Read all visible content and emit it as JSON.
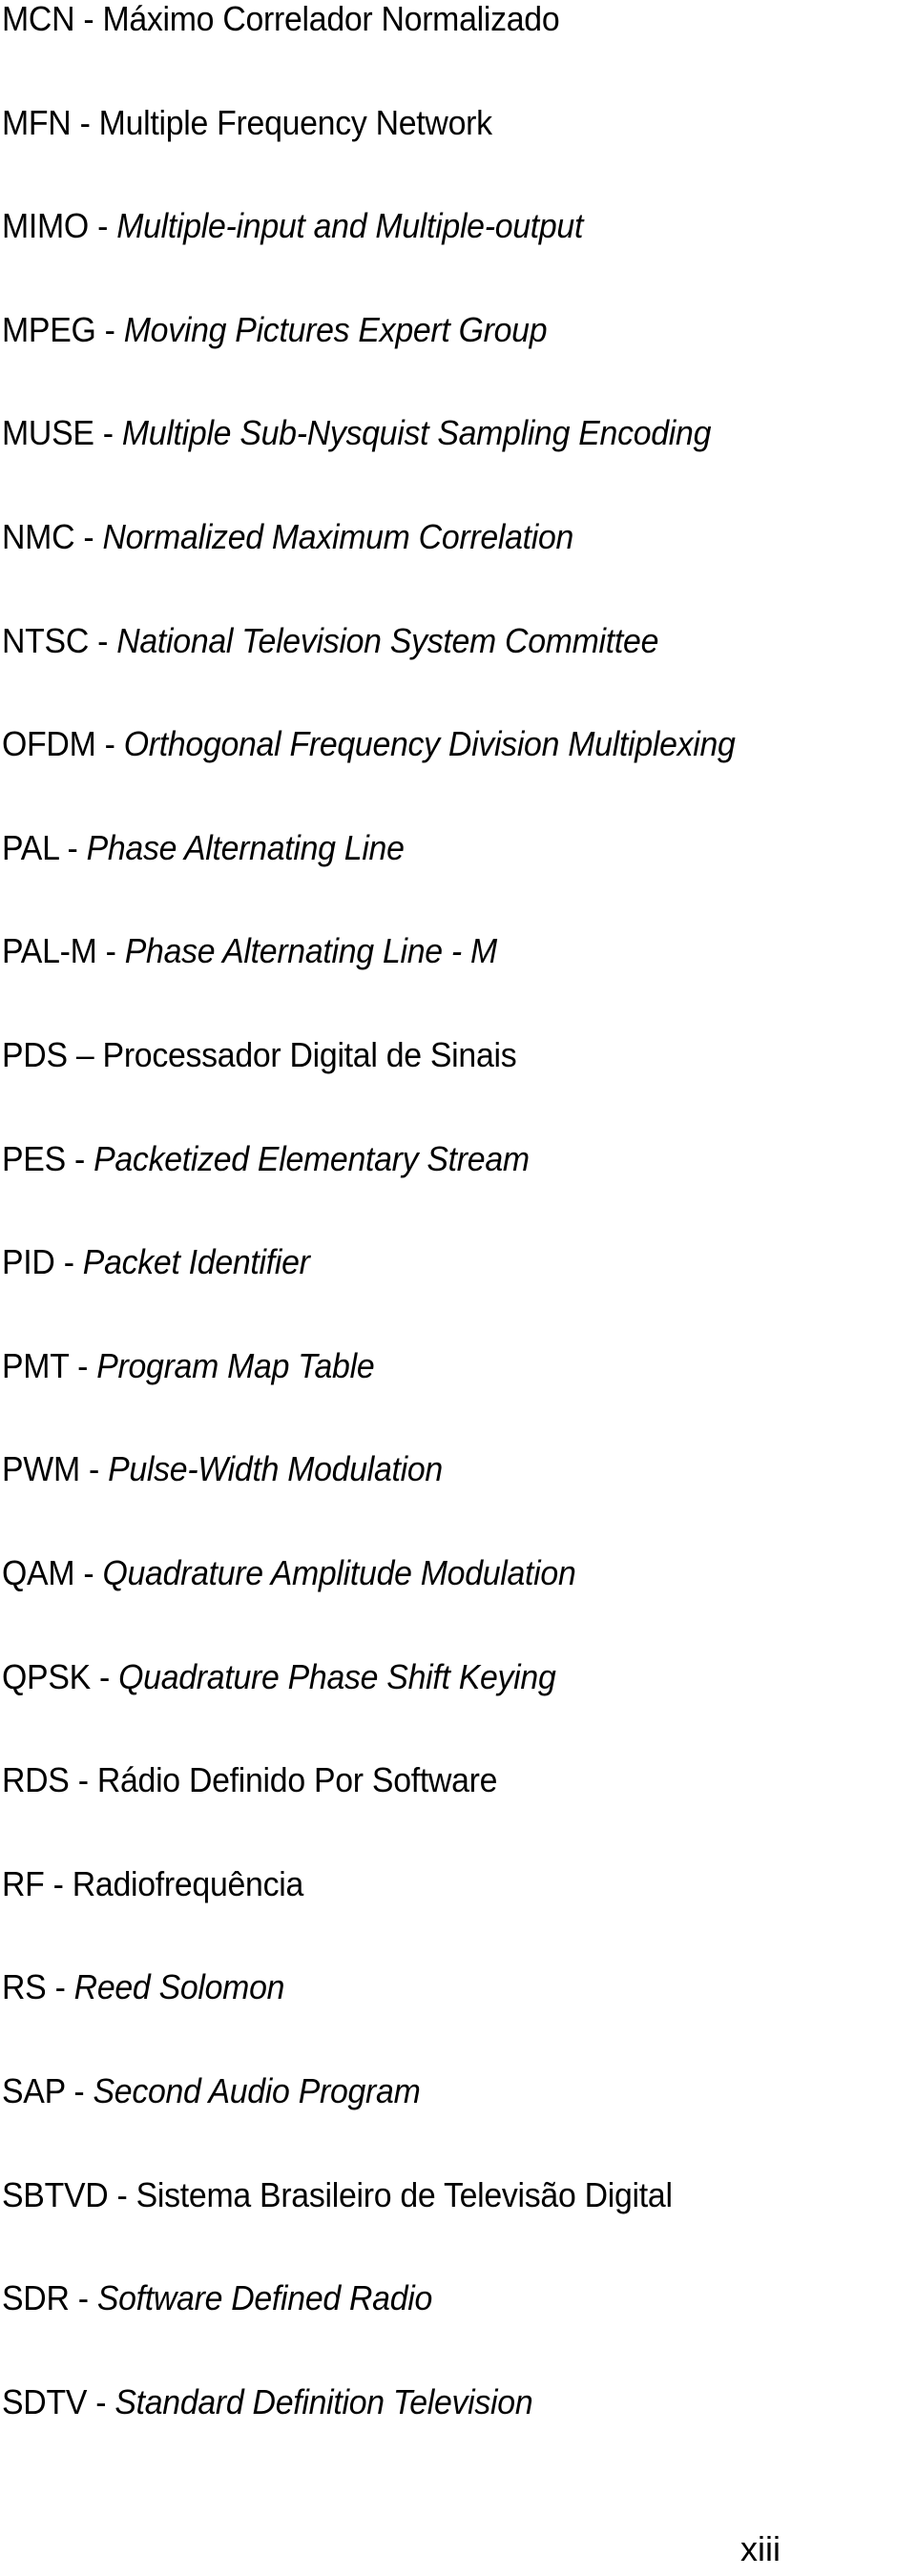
{
  "document": {
    "type": "list-of-abbreviations",
    "entries": [
      {
        "abbr": "MCN",
        "sep": " - ",
        "definition": "Máximo Correlador Normalizado",
        "italic": false
      },
      {
        "abbr": "MFN",
        "sep": " - ",
        "definition": "Multiple Frequency Network",
        "italic": false
      },
      {
        "abbr": "MIMO",
        "sep": " - ",
        "definition": "Multiple-input and Multiple-output",
        "italic": true
      },
      {
        "abbr": "MPEG",
        "sep": " - ",
        "definition": "Moving Pictures Expert Group",
        "italic": true
      },
      {
        "abbr": "MUSE",
        "sep": " - ",
        "definition": "Multiple Sub-Nysquist Sampling Encoding",
        "italic": true
      },
      {
        "abbr": "NMC",
        "sep": " - ",
        "definition": "Normalized Maximum Correlation",
        "italic": true
      },
      {
        "abbr": "NTSC",
        "sep": " - ",
        "definition": "National Television System Committee",
        "italic": true
      },
      {
        "abbr": "OFDM",
        "sep": " - ",
        "definition": "Orthogonal Frequency Division Multiplexing",
        "italic": true
      },
      {
        "abbr": "PAL",
        "sep": " - ",
        "definition": "Phase Alternating Line",
        "italic": true
      },
      {
        "abbr": "PAL-M",
        "sep": " - ",
        "definition": "Phase Alternating Line - M",
        "italic": true
      },
      {
        "abbr": "PDS",
        "sep": " – ",
        "definition": "Processador Digital de Sinais",
        "italic": false
      },
      {
        "abbr": "PES",
        "sep": " - ",
        "definition": "Packetized Elementary Stream",
        "italic": true
      },
      {
        "abbr": "PID",
        "sep": " - ",
        "definition": "Packet Identifier",
        "italic": true
      },
      {
        "abbr": "PMT",
        "sep": " - ",
        "definition": "Program Map Table",
        "italic": true
      },
      {
        "abbr": "PWM",
        "sep": " - ",
        "definition": "Pulse-Width Modulation",
        "italic": true
      },
      {
        "abbr": "QAM",
        "sep": " - ",
        "definition": "Quadrature Amplitude Modulation",
        "italic": true
      },
      {
        "abbr": "QPSK",
        "sep": " - ",
        "definition": "Quadrature Phase Shift Keying",
        "italic": true
      },
      {
        "abbr": "RDS",
        "sep": " - ",
        "definition": "Rádio Definido Por Software",
        "italic": false
      },
      {
        "abbr": "RF",
        "sep": " - ",
        "definition": "Radiofrequência",
        "italic": false
      },
      {
        "abbr": "RS",
        "sep": " - ",
        "definition": "Reed Solomon",
        "italic": true
      },
      {
        "abbr": "SAP",
        "sep": " - ",
        "definition": "Second Audio Program",
        "italic": true
      },
      {
        "abbr": "SBTVD",
        "sep": " - ",
        "definition": "Sistema Brasileiro de Televisão Digital",
        "italic": false
      },
      {
        "abbr": "SDR",
        "sep": " - ",
        "definition": "Software Defined Radio",
        "italic": true
      },
      {
        "abbr": "SDTV",
        "sep": " - ",
        "definition": "Standard Definition Television",
        "italic": true
      }
    ],
    "page_number": "xiii"
  },
  "colors": {
    "text": "#000000",
    "background": "#ffffff"
  }
}
